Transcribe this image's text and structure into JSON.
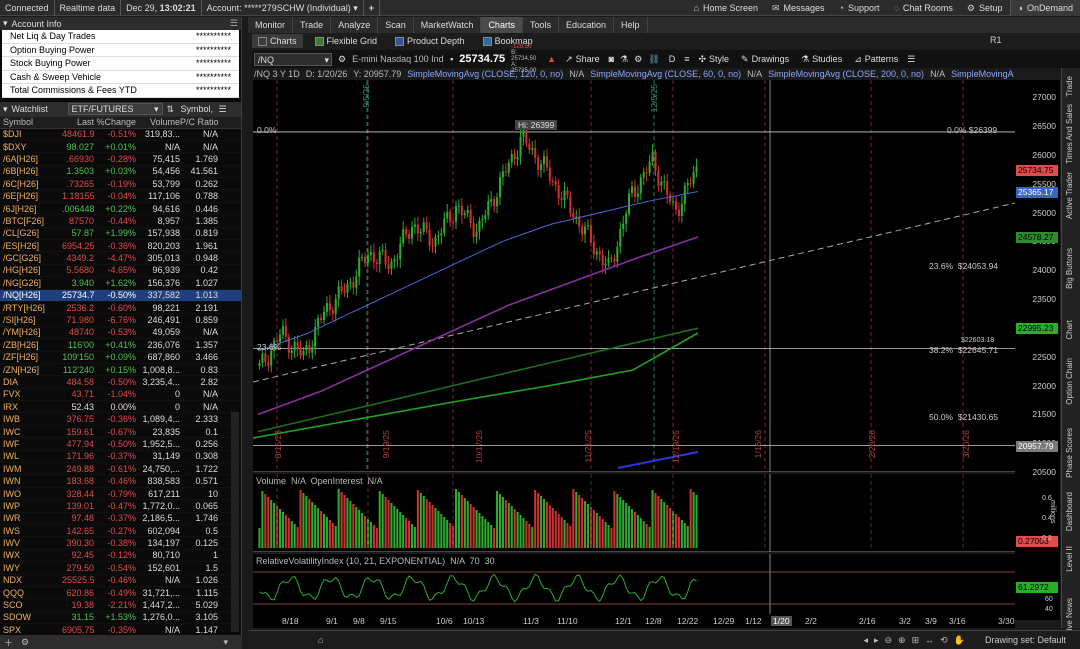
{
  "topbar": {
    "connected": "Connected",
    "realtime": "Realtime data",
    "datetime": "Dec 29",
    "time": "13:02:21",
    "account": "Account: *****279SCHW (Individual)",
    "home": "Home Screen",
    "messages": "Messages",
    "support": "Support",
    "chatrooms": "Chat Rooms",
    "setup": "Setup",
    "ondemand": "OnDemand"
  },
  "account": {
    "title": "Account Info",
    "rows": [
      {
        "label": "Net Liq & Day Trades",
        "value": "**********"
      },
      {
        "label": "Option Buying Power",
        "value": "**********"
      },
      {
        "label": "Stock Buying Power",
        "value": "**********"
      },
      {
        "label": "Cash & Sweep Vehicle",
        "value": "**********"
      },
      {
        "label": "Total Commissions & Fees YTD",
        "value": "**********"
      }
    ]
  },
  "watchlist": {
    "title": "Watchlist",
    "list": "ETF/FUTURES",
    "symbol_col": "Symbol,",
    "columns": [
      "Symbol",
      "Last",
      "%Change",
      "Volume",
      "P/C Ratio"
    ],
    "rows": [
      {
        "s": "$DJI",
        "last": "48461.93",
        "chg": "-0.51%",
        "vol": "319,83...",
        "pc": "N/A",
        "d": "dn"
      },
      {
        "s": "$DXY",
        "last": "98.027",
        "chg": "+0.01%",
        "vol": "N/A",
        "pc": "N/A",
        "d": "up"
      },
      {
        "s": "/6A[H26]",
        "last": ".66930",
        "chg": "-0.28%",
        "vol": "75,415",
        "pc": "1.769",
        "d": "dn"
      },
      {
        "s": "/6B[H26]",
        "last": "1.3503",
        "chg": "+0.03%",
        "vol": "54,456",
        "pc": "41.561",
        "d": "up"
      },
      {
        "s": "/6C[H26]",
        "last": ".73265",
        "chg": "-0.19%",
        "vol": "53,799",
        "pc": "0.262",
        "d": "dn"
      },
      {
        "s": "/6E[H26]",
        "last": "1.18155",
        "chg": "-0.04%",
        "vol": "117,106",
        "pc": "0.788",
        "d": "dn"
      },
      {
        "s": "/6J[H26]",
        "last": ".0064480",
        "chg": "+0.22%",
        "vol": "94,616",
        "pc": "0.446",
        "d": "up"
      },
      {
        "s": "/BTC[F26]",
        "last": "87570",
        "chg": "-0.44%",
        "vol": "8,957",
        "pc": "1.385",
        "d": "dn"
      },
      {
        "s": "/CL[G26]",
        "last": "57.87",
        "chg": "+1.99%",
        "vol": "157,938",
        "pc": "0.819",
        "d": "up"
      },
      {
        "s": "/ES[H26]",
        "last": "6954.25",
        "chg": "-0.36%",
        "vol": "820,203",
        "pc": "1.961",
        "d": "dn"
      },
      {
        "s": "/GC[G26]",
        "last": "4349.2",
        "chg": "-4.47%",
        "vol": "305,013",
        "pc": "0.948",
        "d": "dn"
      },
      {
        "s": "/HG[H26]",
        "last": "5.5680",
        "chg": "-4.65%",
        "vol": "96,939",
        "pc": "0.42",
        "d": "dn"
      },
      {
        "s": "/NG[G26]",
        "last": "3.940",
        "chg": "+1.62%",
        "vol": "156,376",
        "pc": "1.027",
        "d": "up"
      },
      {
        "s": "/NQ[H26]",
        "last": "25734.75",
        "chg": "-0.50%",
        "vol": "337,582",
        "pc": "1.013",
        "d": "dn",
        "sel": true
      },
      {
        "s": "/RTY[H26]",
        "last": "2536.2",
        "chg": "-0.60%",
        "vol": "98,221",
        "pc": "2.191",
        "d": "dn"
      },
      {
        "s": "/SI[H26]",
        "last": "71.980",
        "chg": "-6.76%",
        "vol": "246,491",
        "pc": "0.859",
        "d": "dn"
      },
      {
        "s": "/YM[H26]",
        "last": "48740",
        "chg": "-0.53%",
        "vol": "49,059",
        "pc": "N/A",
        "d": "dn"
      },
      {
        "s": "/ZB[H26]",
        "last": "116'00",
        "chg": "+0.41%",
        "vol": "236,076",
        "pc": "1.357",
        "d": "up"
      },
      {
        "s": "/ZF[H26]",
        "last": "109'150",
        "chg": "+0.09%",
        "vol": "687,860",
        "pc": "3.466",
        "d": "up"
      },
      {
        "s": "/ZN[H26]",
        "last": "112'240",
        "chg": "+0.15%",
        "vol": "1,008,8...",
        "pc": "0.83",
        "d": "up"
      },
      {
        "s": "DIA",
        "last": "484.58",
        "chg": "-0.50%",
        "vol": "3,235,4...",
        "pc": "2.82",
        "d": "dn",
        "dot": true
      },
      {
        "s": "FVX",
        "last": "43.71",
        "chg": "-1.04%",
        "vol": "0",
        "pc": "N/A",
        "d": "dn"
      },
      {
        "s": "IRX",
        "last": "52.43",
        "chg": "0.00%",
        "vol": "0",
        "pc": "N/A",
        "d": "nu"
      },
      {
        "s": "IWB",
        "last": "376.75",
        "chg": "-0.36%",
        "vol": "1,089,4...",
        "pc": "2.333",
        "d": "dn",
        "dot": true
      },
      {
        "s": "IWC",
        "last": "159.61",
        "chg": "-0.67%",
        "vol": "23,835",
        "pc": "0.1",
        "d": "dn"
      },
      {
        "s": "IWF",
        "last": "477.94",
        "chg": "-0.50%",
        "vol": "1,952,5...",
        "pc": "0.256",
        "d": "dn"
      },
      {
        "s": "IWL",
        "last": "171.96",
        "chg": "-0.37%",
        "vol": "31,149",
        "pc": "0.308",
        "d": "dn"
      },
      {
        "s": "IWM",
        "last": "249.88",
        "chg": "-0.61%",
        "vol": "24,750,...",
        "pc": "1.722",
        "d": "dn",
        "dot": true
      },
      {
        "s": "IWN",
        "last": "183.68",
        "chg": "-0.46%",
        "vol": "838,583",
        "pc": "0.571",
        "d": "dn",
        "dot": true
      },
      {
        "s": "IWO",
        "last": "328.44",
        "chg": "-0.79%",
        "vol": "617,211",
        "pc": "10",
        "d": "dn",
        "dot": true
      },
      {
        "s": "IWP",
        "last": "139.01",
        "chg": "-0.47%",
        "vol": "1,772,0...",
        "pc": "0.065",
        "d": "dn"
      },
      {
        "s": "IWR",
        "last": "97.48",
        "chg": "-0.37%",
        "vol": "2,186,5...",
        "pc": "1.746",
        "d": "dn",
        "dot": true
      },
      {
        "s": "IWS",
        "last": "142.65",
        "chg": "-0.27%",
        "vol": "602,094",
        "pc": "0.5",
        "d": "dn"
      },
      {
        "s": "IWV",
        "last": "390.30",
        "chg": "-0.38%",
        "vol": "134,197",
        "pc": "0.125",
        "d": "dn",
        "dot": true
      },
      {
        "s": "IWX",
        "last": "92.45",
        "chg": "-0.12%",
        "vol": "80,710",
        "pc": "1",
        "d": "dn"
      },
      {
        "s": "IWY",
        "last": "279.50",
        "chg": "-0.54%",
        "vol": "152,601",
        "pc": "1.5",
        "d": "dn"
      },
      {
        "s": "NDX",
        "last": "25525.5...",
        "chg": "-0.46%",
        "vol": "N/A",
        "pc": "1.026",
        "d": "dn"
      },
      {
        "s": "QQQ",
        "last": "620.86",
        "chg": "-0.49%",
        "vol": "31,721,...",
        "pc": "1.115",
        "d": "dn",
        "dot": true
      },
      {
        "s": "SCO",
        "last": "19.38",
        "chg": "-2.21%",
        "vol": "1,447,2...",
        "pc": "5.029",
        "d": "dn",
        "dot": true
      },
      {
        "s": "SDOW",
        "last": "31.15",
        "chg": "+1.53%",
        "vol": "1,276,0...",
        "pc": "3.105",
        "d": "up",
        "dot": true
      },
      {
        "s": "SPX",
        "last": "6905.75",
        "chg": "-0.35%",
        "vol": "N/A",
        "pc": "1.147",
        "d": "dn"
      }
    ]
  },
  "tabs": [
    "Monitor",
    "Trade",
    "Analyze",
    "Scan",
    "MarketWatch",
    "Charts",
    "Tools",
    "Education",
    "Help"
  ],
  "subtabs": [
    "Charts",
    "Flexible Grid",
    "Product Depth",
    "Bookmap"
  ],
  "chart_toolbar": {
    "symbol": "/NQ",
    "name": "E-mini Nasdaq 100 Index Futures,...",
    "price": "25734.75",
    "bid": "-128.50",
    "b_label": "B: 25734.50",
    "a_label": "A: 25735.00",
    "share": "Share",
    "period": "D",
    "style": "Style",
    "drawings": "Drawings",
    "studies": "Studies",
    "patterns": "Patterns",
    "r1": "R1"
  },
  "study_line": {
    "sym": "/NQ 3 Y 1D",
    "d": "D: 1/20/26",
    "val": "Y: 20957.79",
    "sma1": "SimpleMovingAvg (CLOSE, 120, 0, no)",
    "sma2": "SimpleMovingAvg (CLOSE, 60, 0, no)",
    "sma3": "SimpleMovingAvg (CLOSE, 200, 0, no)",
    "sma4": "SimpleMovingAvg",
    "na": "N/A"
  },
  "chart_labels": {
    "hi": "Hi: 26399",
    "pct0_left": "0.0%",
    "pct0_right": "0.0%",
    "pct0_val": "$26399",
    "pct236_left": "23.6%",
    "pct236_right": "23.6%",
    "pct236_val": "$24053.94",
    "pct382": "38.2%",
    "pct382_val": "$22645.71",
    "pct382_val2": "$22603.18",
    "pct50": "50.0%",
    "pct50_val": "$21430.65",
    "dates": [
      "8/15/25",
      "9/19/25",
      "10/17/25",
      "11/21/25",
      "12/19/25",
      "1/16/26",
      "2/20/26",
      "3/20/26"
    ],
    "dates_top": [
      "9/5/25",
      "12/5/25"
    ]
  },
  "yaxis": {
    "ticks": [
      "27000",
      "26500",
      "26000",
      "25500",
      "25000",
      "24500",
      "24000",
      "23500",
      "23000",
      "22500",
      "22000",
      "21500",
      "21000",
      "20500"
    ],
    "boxes": [
      {
        "label": "25734.75",
        "color": "#e04b4b"
      },
      {
        "label": "25365.17",
        "color": "#3a63c8"
      },
      {
        "label": "24578.27",
        "color": "#2e8b2e"
      },
      {
        "label": "22995.23",
        "color": "#26b026"
      },
      {
        "label": "20957.79",
        "color": "#7a7a7a"
      }
    ]
  },
  "volume": {
    "title": "Volume",
    "na": "N/A",
    "oi": "OpenInterest",
    "oi_na": "N/A",
    "axis_label": "millions",
    "box": "0.27003",
    "ticks": [
      "0.6",
      "0.4",
      "0.2"
    ]
  },
  "rvi": {
    "title": "RelativeVolatilityIndex (10, 21, EXPONENTIAL)",
    "na": "N/A",
    "l70": "70",
    "l30": "30",
    "box": "61.2972",
    "ticks": [
      "60",
      "40"
    ]
  },
  "xaxis": {
    "labels": [
      "8/18",
      "9/1",
      "9/8",
      "9/15",
      "10/6",
      "10/13",
      "11/3",
      "11/10",
      "12/1",
      "12/8",
      "12/22",
      "12/29",
      "1/12",
      "1/20",
      "2/2",
      "2/16",
      "3/2",
      "3/9",
      "3/16",
      "3/30"
    ],
    "current": "1/20"
  },
  "bottom": {
    "drawing_set": "Drawing set: Default"
  },
  "rightbar": [
    "Trade",
    "Times And Sales",
    "Active Trader",
    "Big Buttons",
    "Chart",
    "Option Chain",
    "Phase Scores",
    "Dashboard",
    "Level II",
    "Live News"
  ],
  "chart_data": {
    "type": "line",
    "title": "/NQ 3 Y 1D",
    "ylim": [
      20500,
      27300
    ],
    "series": [
      {
        "name": "/NQ",
        "values": [
          22300,
          22900,
          22500,
          23300,
          23700,
          24300,
          24100,
          24800,
          24500,
          25100,
          24700,
          25500,
          26300,
          25800,
          25200,
          24600,
          24000,
          25300,
          25900,
          25000,
          25734.75
        ]
      },
      {
        "name": "SimpleMovingAvg (CLOSE, 60, 0, no)",
        "values": [
          22600,
          22900,
          23300,
          23700,
          24100,
          24500,
          24800,
          25000,
          25200,
          25365
        ]
      },
      {
        "name": "SimpleMovingAvg (CLOSE, 120, 0, no)",
        "values": [
          21500,
          21900,
          22400,
          22900,
          23400,
          23800,
          24200,
          24578
        ]
      },
      {
        "name": "SimpleMovingAvg (CLOSE, 200, 0, no)",
        "values": [
          21200,
          21500,
          21800,
          22100,
          22400,
          22700,
          22995
        ]
      }
    ]
  }
}
